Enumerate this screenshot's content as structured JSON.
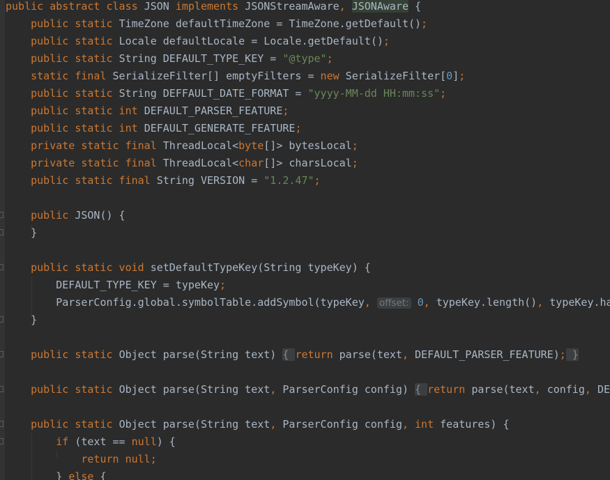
{
  "editor": {
    "lines": [
      [
        [
          "kw",
          "public abstract class "
        ],
        [
          "",
          "JSON "
        ],
        [
          "kw",
          "implements "
        ],
        [
          "",
          "JSONStreamAware"
        ],
        [
          "kw",
          ", "
        ],
        [
          "hl",
          "JSONAware"
        ],
        [
          "",
          " {"
        ]
      ],
      [
        [
          "",
          "    "
        ],
        [
          "kw",
          "public static "
        ],
        [
          "",
          "TimeZone defaultTimeZone = TimeZone."
        ],
        [
          "",
          "getDefault"
        ],
        [
          "",
          "()"
        ],
        [
          "kw",
          ";"
        ]
      ],
      [
        [
          "",
          "    "
        ],
        [
          "kw",
          "public static "
        ],
        [
          "",
          "Locale defaultLocale = Locale."
        ],
        [
          "",
          "getDefault"
        ],
        [
          "",
          "()"
        ],
        [
          "kw",
          ";"
        ]
      ],
      [
        [
          "",
          "    "
        ],
        [
          "kw",
          "public static "
        ],
        [
          "",
          "String DEFAULT_TYPE_KEY = "
        ],
        [
          "str",
          "\"@type\""
        ],
        [
          "kw",
          ";"
        ]
      ],
      [
        [
          "",
          "    "
        ],
        [
          "kw",
          "static final "
        ],
        [
          "",
          "SerializeFilter[] emptyFilters = "
        ],
        [
          "kw",
          "new "
        ],
        [
          "",
          "SerializeFilter["
        ],
        [
          "num",
          "0"
        ],
        [
          "",
          "]"
        ],
        [
          "kw",
          ";"
        ]
      ],
      [
        [
          "",
          "    "
        ],
        [
          "kw",
          "public static "
        ],
        [
          "",
          "String DEFFAULT_DATE_FORMAT = "
        ],
        [
          "str",
          "\"yyyy-MM-dd HH:mm:ss\""
        ],
        [
          "kw",
          ";"
        ]
      ],
      [
        [
          "",
          "    "
        ],
        [
          "kw",
          "public static int "
        ],
        [
          "",
          "DEFAULT_PARSER_FEATURE"
        ],
        [
          "kw",
          ";"
        ]
      ],
      [
        [
          "",
          "    "
        ],
        [
          "kw",
          "public static int "
        ],
        [
          "",
          "DEFAULT_GENERATE_FEATURE"
        ],
        [
          "kw",
          ";"
        ]
      ],
      [
        [
          "",
          "    "
        ],
        [
          "kw",
          "private static final "
        ],
        [
          "",
          "ThreadLocal<"
        ],
        [
          "kw",
          "byte"
        ],
        [
          "",
          "[]> bytesLocal"
        ],
        [
          "kw",
          ";"
        ]
      ],
      [
        [
          "",
          "    "
        ],
        [
          "kw",
          "private static final "
        ],
        [
          "",
          "ThreadLocal<"
        ],
        [
          "kw",
          "char"
        ],
        [
          "",
          "[]> charsLocal"
        ],
        [
          "kw",
          ";"
        ]
      ],
      [
        [
          "",
          "    "
        ],
        [
          "kw",
          "public static final "
        ],
        [
          "",
          "String VERSION = "
        ],
        [
          "str",
          "\"1.2.47\""
        ],
        [
          "kw",
          ";"
        ]
      ],
      [],
      [
        [
          "",
          "    "
        ],
        [
          "kw",
          "public "
        ],
        [
          "",
          "JSON() {"
        ]
      ],
      [
        [
          "",
          "    }"
        ]
      ],
      [],
      [
        [
          "",
          "    "
        ],
        [
          "kw",
          "public static void "
        ],
        [
          "",
          "setDefaultTypeKey(String typeKey) {"
        ]
      ],
      [
        [
          "",
          "        DEFAULT_TYPE_KEY = typeKey"
        ],
        [
          "kw",
          ";"
        ]
      ],
      [
        [
          "",
          "        ParserConfig."
        ],
        [
          "",
          "global"
        ],
        [
          "",
          "."
        ],
        [
          "",
          "symbolTable"
        ],
        [
          "",
          ".addSymbol(typeKey"
        ],
        [
          "kw",
          ", "
        ],
        [
          "hint",
          "offset:"
        ],
        [
          "num",
          " 0"
        ],
        [
          "kw",
          ", "
        ],
        [
          "",
          "typeKey.length()"
        ],
        [
          "kw",
          ", "
        ],
        [
          "",
          "typeKey.ha"
        ]
      ],
      [
        [
          "",
          "    }"
        ]
      ],
      [],
      [
        [
          "",
          "    "
        ],
        [
          "kw",
          "public static "
        ],
        [
          "",
          "Object parse(String text) "
        ],
        [
          "bf",
          "{ "
        ],
        [
          "kw",
          "return "
        ],
        [
          "",
          "parse(text"
        ],
        [
          "kw",
          ", "
        ],
        [
          "",
          "DEFAULT_PARSER_FEATURE)"
        ],
        [
          "kw",
          ";"
        ],
        [
          "bf",
          " }"
        ]
      ],
      [],
      [
        [
          "",
          "    "
        ],
        [
          "kw",
          "public static "
        ],
        [
          "",
          "Object parse(String text"
        ],
        [
          "kw",
          ", "
        ],
        [
          "",
          "ParserConfig config) "
        ],
        [
          "bf",
          "{ "
        ],
        [
          "kw",
          "return "
        ],
        [
          "",
          "parse(text"
        ],
        [
          "kw",
          ", "
        ],
        [
          "",
          "config"
        ],
        [
          "kw",
          ", "
        ],
        [
          "",
          "DEF"
        ]
      ],
      [],
      [
        [
          "",
          "    "
        ],
        [
          "kw",
          "public static "
        ],
        [
          "",
          "Object parse(String text"
        ],
        [
          "kw",
          ", "
        ],
        [
          "",
          "ParserConfig config"
        ],
        [
          "kw",
          ", int "
        ],
        [
          "",
          "features) {"
        ]
      ],
      [
        [
          "",
          "        "
        ],
        [
          "kw",
          "if "
        ],
        [
          "",
          "(text == "
        ],
        [
          "kw",
          "null"
        ],
        [
          "",
          ") {"
        ]
      ],
      [
        [
          "",
          "            "
        ],
        [
          "kw",
          "return null;"
        ]
      ],
      [
        [
          "",
          "        } "
        ],
        [
          "kw",
          "else "
        ],
        [
          "",
          "{"
        ]
      ]
    ]
  }
}
